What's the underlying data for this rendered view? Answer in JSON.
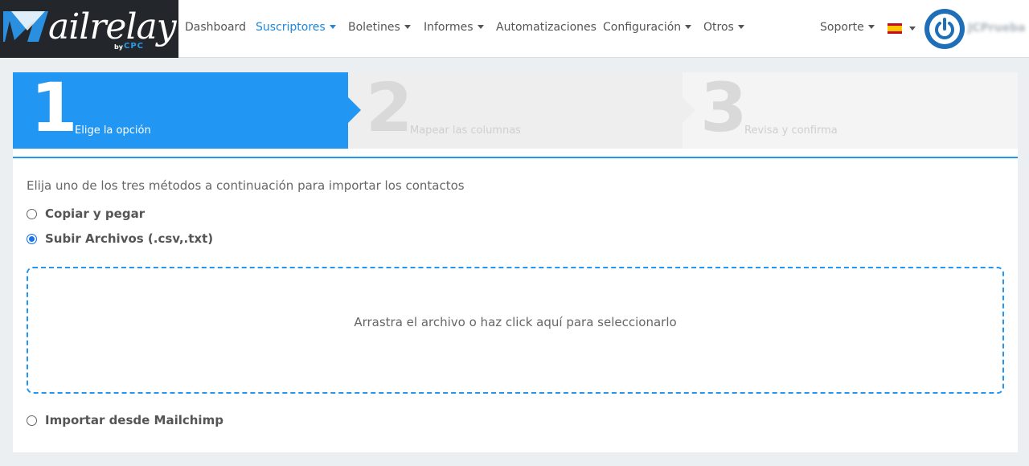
{
  "brand": {
    "name": "ailrelay",
    "by": "by",
    "cpc": "CPC"
  },
  "nav": {
    "dashboard": "Dashboard",
    "suscriptores": "Suscriptores",
    "boletines": "Boletines",
    "informes": "Informes",
    "automatizaciones": "Automatizaciones",
    "configuracion": "Configuración",
    "otros": "Otros",
    "soporte": "Soporte",
    "username": "JCPrueba"
  },
  "steps": [
    {
      "number": "1",
      "label": "Elige la opción",
      "active": true
    },
    {
      "number": "2",
      "label": "Mapear las columnas",
      "active": false
    },
    {
      "number": "3",
      "label": "Revisa y confirma",
      "active": false
    }
  ],
  "intro": "Elija uno de los tres métodos a continuación para importar los contactos",
  "options": [
    {
      "label": "Copiar y pegar",
      "checked": false
    },
    {
      "label": "Subir Archivos (.csv,.txt)",
      "checked": true
    },
    {
      "label": "Importar desde Mailchimp",
      "checked": false
    }
  ],
  "dropzone": {
    "text": "Arrastra el archivo o haz click aquí para seleccionarlo"
  },
  "colors": {
    "accent": "#2196f3",
    "nav_active": "#2187d9",
    "logo_bg": "#23272c"
  }
}
